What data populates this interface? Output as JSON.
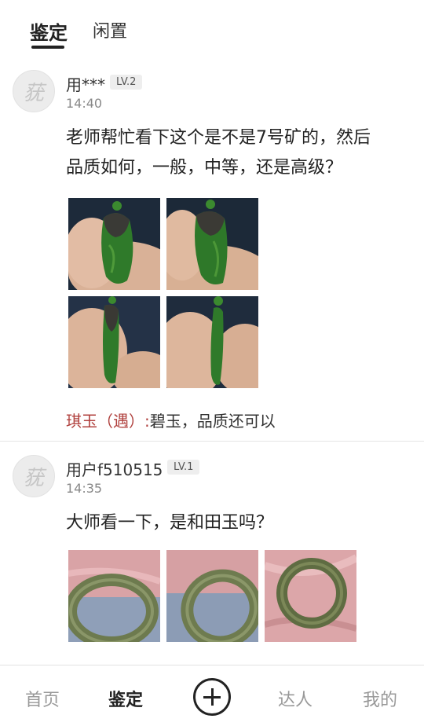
{
  "top_tabs": [
    {
      "label": "鉴定",
      "active": true
    },
    {
      "label": "闲置",
      "active": false
    }
  ],
  "posts": [
    {
      "username": "用***",
      "level": "LV.2",
      "time": "14:40",
      "question_lines": [
        "老师帮忙看下这个是不是7号矿的，然后",
        "品质如何，一般，中等，还是高级？"
      ],
      "photos": [
        "green-jade-pendant-photo",
        "green-jade-pendant-photo",
        "green-jade-pendant-photo",
        "green-jade-pendant-photo"
      ],
      "answer": {
        "author": "琪玉（遇）:",
        "text": "碧玉，品质还可以"
      }
    },
    {
      "username": "用户f510515",
      "level": "LV.1",
      "time": "14:35",
      "question_lines": [
        "大师看一下，是和田玉吗？"
      ],
      "photos": [
        "jade-bangle-photo",
        "jade-bangle-photo",
        "jade-bangle-photo"
      ]
    }
  ],
  "avatar_glyph": "莸",
  "bottom_nav": [
    {
      "label": "首页",
      "active": false
    },
    {
      "label": "鉴定",
      "active": true
    },
    {
      "label": "达人",
      "active": false
    },
    {
      "label": "我的",
      "active": false
    }
  ],
  "colors": {
    "answer_author": "#b0413e",
    "jade_green": "#2f7a2a",
    "bangle": "#6d7a4e"
  }
}
